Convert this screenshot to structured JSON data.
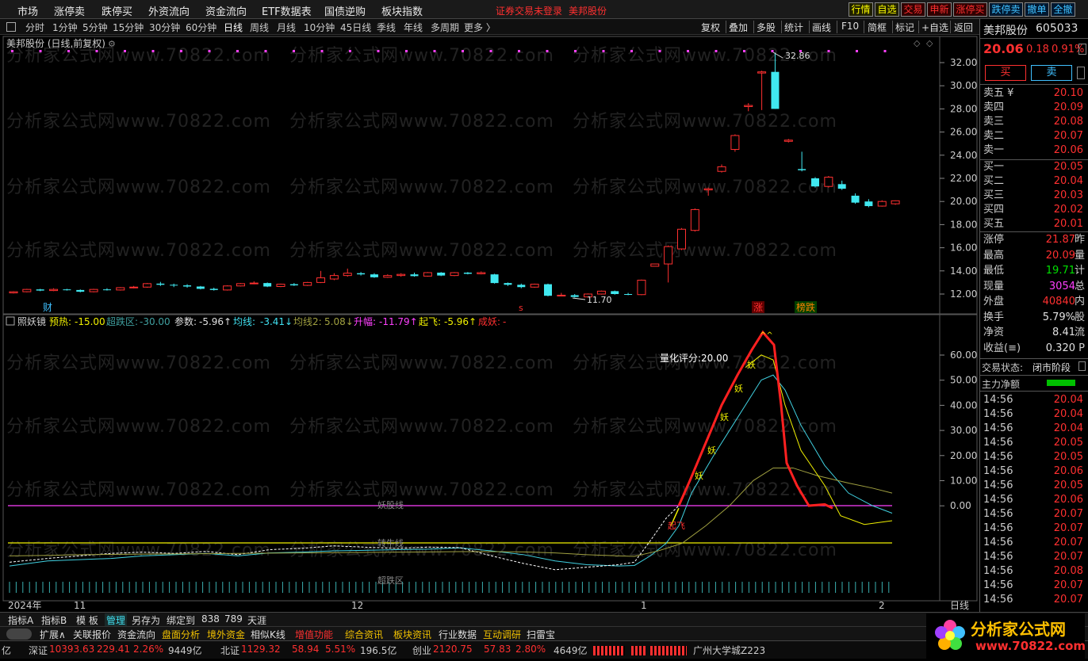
{
  "menubar": {
    "items": [
      "市场",
      "涨停卖",
      "跌停买",
      "外资流向",
      "资金流向",
      "ETF数据表",
      "国债逆购",
      "板块指数"
    ],
    "warning": "证券交易未登录",
    "stock_name_warn": "美邦股份",
    "right_buttons": [
      "行情",
      "自选",
      "交易",
      "申新",
      "涨停买",
      "跌停卖",
      "撤单",
      "全撤"
    ]
  },
  "periodbar": {
    "items": [
      "分时",
      "1分钟",
      "5分钟",
      "15分钟",
      "30分钟",
      "60分钟",
      "日线",
      "周线",
      "月线",
      "10分钟",
      "45日线",
      "季线",
      "年线",
      "多周期",
      "更多 〉"
    ],
    "active": "日线",
    "right_items": [
      "复权",
      "叠加",
      "多股",
      "统计",
      "画线",
      "F10",
      "简框",
      "标记",
      "+自选",
      "返回"
    ]
  },
  "kline": {
    "title": "美邦股份 (日线,前复权)",
    "price_ticks": [
      "32.00",
      "30.00",
      "28.00",
      "26.00",
      "24.00",
      "22.00",
      "20.00",
      "18.00",
      "16.00",
      "14.00",
      "12.00"
    ],
    "high_label": "32.86",
    "low_label": "11.70",
    "markers": {
      "cai": "财",
      "s": "s",
      "zhang": "涨",
      "bangdie": "榜跌"
    }
  },
  "indicator": {
    "name": "照妖镜",
    "items": [
      {
        "label": "预热:",
        "value": "-15.00"
      },
      {
        "label": "超跌区:",
        "value": "-30.00"
      },
      {
        "label": "参数:",
        "value": "-5.96↑"
      },
      {
        "label": "均线:",
        "value": "-3.41↓"
      },
      {
        "label": "均线2:",
        "value": "5.08↓"
      },
      {
        "label": "升幅:",
        "value": "-11.79↑"
      },
      {
        "label": "起飞:",
        "value": "-5.96↑"
      },
      {
        "label": "成妖:",
        "value": "-"
      }
    ],
    "ticks": [
      "60.00",
      "50.00",
      "40.00",
      "30.00",
      "20.00",
      "10.00",
      "0.00"
    ],
    "score_label": "量化评分:20.00",
    "yao": "妖",
    "qifei": "起飞",
    "peak": "^^",
    "lines": {
      "yaogu": "妖股线",
      "zhuanniu": "转牛线",
      "chaodie": "超跌区"
    }
  },
  "xaxis": {
    "labels": [
      "2024年",
      "11",
      "12",
      "1",
      "2"
    ],
    "right": "日线"
  },
  "rightpanel": {
    "name": "美邦股份",
    "code": "605033",
    "price": "20.06",
    "change": "0.18",
    "pct": "0.91%",
    "buy": "买",
    "sell": "卖",
    "asks": [
      {
        "label": "卖五 ¥",
        "price": "20.10"
      },
      {
        "label": "卖四",
        "price": "20.09"
      },
      {
        "label": "卖三",
        "price": "20.08"
      },
      {
        "label": "卖二",
        "price": "20.07"
      },
      {
        "label": "卖一",
        "price": "20.06"
      }
    ],
    "bids": [
      {
        "label": "买一",
        "price": "20.05"
      },
      {
        "label": "买二",
        "price": "20.04"
      },
      {
        "label": "买三",
        "price": "20.03"
      },
      {
        "label": "买四",
        "price": "20.02"
      },
      {
        "label": "买五",
        "price": "20.01"
      }
    ],
    "stats": [
      {
        "label": "涨停",
        "value": "21.87",
        "extra": "昨"
      },
      {
        "label": "最高",
        "value": "20.09",
        "extra": "量"
      },
      {
        "label": "最低",
        "value": "19.71",
        "extra": "计"
      },
      {
        "label": "现量",
        "value": "3054",
        "extra": "总"
      },
      {
        "label": "外盘",
        "value": "40840",
        "extra": "内"
      },
      {
        "label": "换手",
        "value": "5.79%",
        "extra": "股"
      },
      {
        "label": "净资",
        "value": "8.41",
        "extra": "流"
      },
      {
        "label": "收益(≡)",
        "value": "0.320",
        "extra": "P"
      }
    ],
    "trade_state_label": "交易状态:",
    "trade_state": "闭市阶段",
    "main_net": "主力净额",
    "ticks": [
      {
        "t": "14:56",
        "p": "20.04"
      },
      {
        "t": "14:56",
        "p": "20.04"
      },
      {
        "t": "14:56",
        "p": "20.04"
      },
      {
        "t": "14:56",
        "p": "20.05"
      },
      {
        "t": "14:56",
        "p": "20.05"
      },
      {
        "t": "14:56",
        "p": "20.06"
      },
      {
        "t": "14:56",
        "p": "20.05"
      },
      {
        "t": "14:56",
        "p": "20.06"
      },
      {
        "t": "14:56",
        "p": "20.07"
      },
      {
        "t": "14:56",
        "p": "20.07"
      },
      {
        "t": "14:56",
        "p": "20.07"
      },
      {
        "t": "14:56",
        "p": "20.07"
      },
      {
        "t": "14:56",
        "p": "20.08"
      },
      {
        "t": "14:56",
        "p": "20.07"
      },
      {
        "t": "14:56",
        "p": "20.07"
      }
    ]
  },
  "bottomtabs1": [
    "指标A",
    "指标B",
    "模 板",
    "管理",
    "另存为",
    "绑定到",
    "838",
    "789",
    "天涯"
  ],
  "bottomtabs2": [
    "扩展∧",
    "关联报价",
    "资金流向",
    "盘面分析",
    "境外资金",
    "相似K线",
    "增值功能",
    "综合资讯",
    "板块资讯",
    "行业数据",
    "互动调研",
    "扫雷宝"
  ],
  "statusbar": {
    "left": "亿",
    "sz_label": "深证",
    "sz_val": "10393.63",
    "sz_chg": "229.41",
    "sz_pct": "2.26%",
    "sz_amt": "9449亿",
    "bz_label": "北证",
    "bz_val": "1129.32",
    "bz_chg": "58.94",
    "bz_pct": "5.51%",
    "bz_amt": "196.5亿",
    "cy_label": "创业",
    "cy_val": "2120.75",
    "cy_chg": "57.83",
    "cy_pct": "2.80%",
    "cy_amt": "4649亿",
    "place": "广州大学城Z223"
  },
  "logo": {
    "text": "分析家公式网",
    "url": "www.70822.com"
  },
  "watermark": "分析家公式网www.70822.com",
  "colors": {
    "up": "#ff3030",
    "down": "#40e8f0",
    "yellow": "#f0f000",
    "magenta": "#ff40ff"
  }
}
